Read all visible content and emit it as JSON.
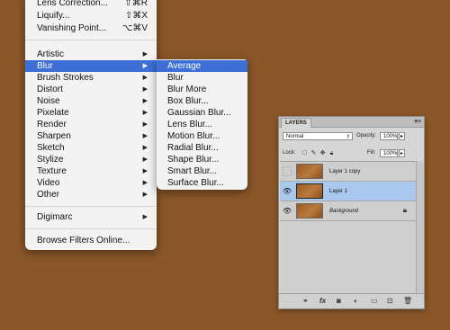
{
  "filter_menu": {
    "items_top": [
      {
        "label": "Lens Correction...",
        "shortcut": "⇧⌘R"
      },
      {
        "label": "Liquify...",
        "shortcut": "⇧⌘X"
      },
      {
        "label": "Vanishing Point...",
        "shortcut": "⌥⌘V"
      }
    ],
    "groups": [
      {
        "label": "Artistic"
      },
      {
        "label": "Blur"
      },
      {
        "label": "Brush Strokes"
      },
      {
        "label": "Distort"
      },
      {
        "label": "Noise"
      },
      {
        "label": "Pixelate"
      },
      {
        "label": "Render"
      },
      {
        "label": "Sharpen"
      },
      {
        "label": "Sketch"
      },
      {
        "label": "Stylize"
      },
      {
        "label": "Texture"
      },
      {
        "label": "Video"
      },
      {
        "label": "Other"
      }
    ],
    "digimarc": "Digimarc",
    "browse": "Browse Filters Online...",
    "highlighted": "Blur"
  },
  "blur_submenu": {
    "items": [
      "Average",
      "Blur",
      "Blur More",
      "Box Blur...",
      "Gaussian Blur...",
      "Lens Blur...",
      "Motion Blur...",
      "Radial Blur...",
      "Shape Blur...",
      "Smart Blur...",
      "Surface Blur..."
    ],
    "highlighted": "Average"
  },
  "layers_panel": {
    "tab": "LAYERS",
    "blend_mode": "Normal",
    "opacity_label": "Opacity:",
    "opacity_value": "100%",
    "lock_label": "Lock:",
    "fill_label": "Fill:",
    "fill_value": "100%",
    "layers": [
      {
        "name": "Layer 1 copy",
        "visible": false,
        "selected": false
      },
      {
        "name": "Layer 1",
        "visible": true,
        "selected": true
      },
      {
        "name": "Background",
        "visible": true,
        "selected": false,
        "locked": true
      }
    ]
  },
  "colors": {
    "background": "#8a5728",
    "highlight": "#3d6fd6",
    "selected_layer": "#a8c8ee"
  }
}
